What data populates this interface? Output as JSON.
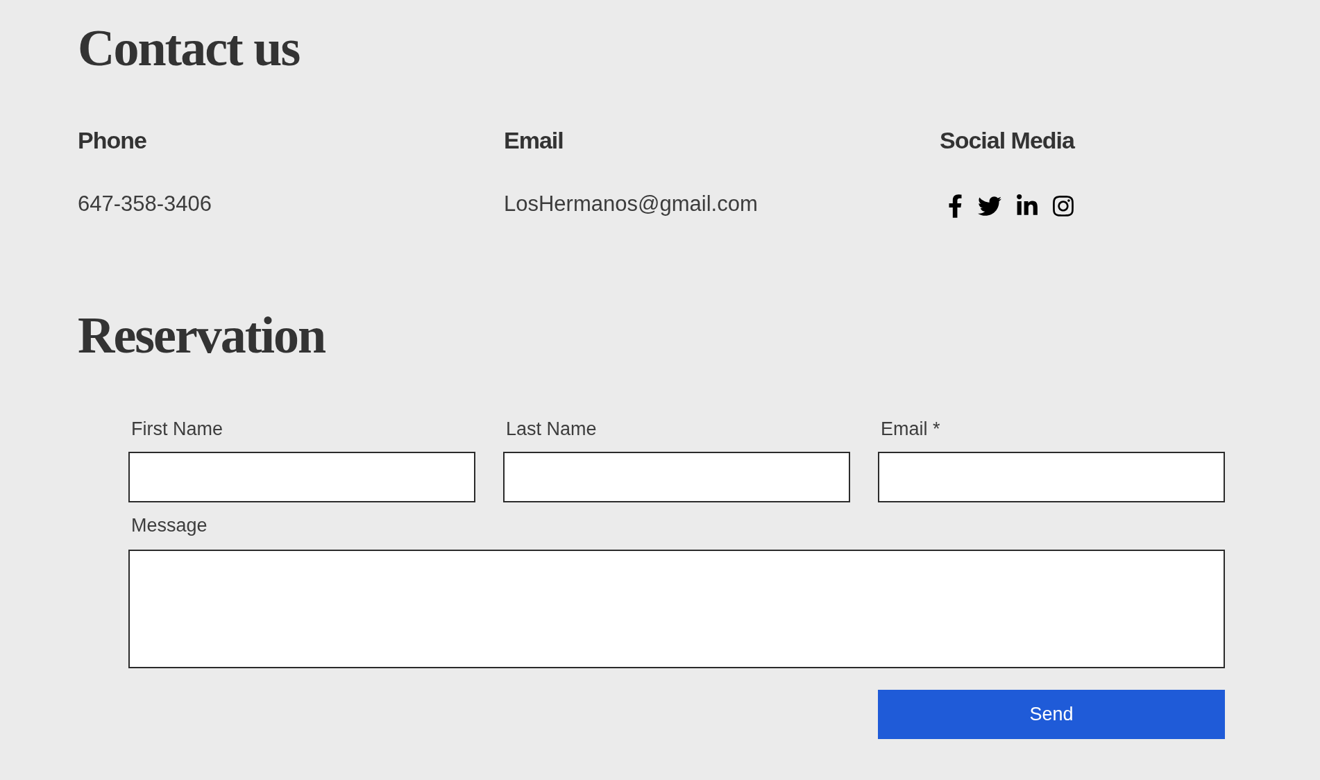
{
  "contact": {
    "title": "Contact us",
    "columns": [
      {
        "kind": "text",
        "heading": "Phone",
        "value": "647-358-3406"
      },
      {
        "kind": "text",
        "heading": "Email",
        "value": "LosHermanos@gmail.com"
      },
      {
        "kind": "social",
        "heading": "Social Media"
      }
    ]
  },
  "reservation": {
    "title": "Reservation",
    "fields": [
      {
        "kind": "text",
        "label": "First Name"
      },
      {
        "kind": "text",
        "label": "Last Name"
      },
      {
        "kind": "text",
        "label": "Email *"
      },
      {
        "kind": "textarea",
        "label": "Message"
      }
    ],
    "submit": "Send"
  }
}
